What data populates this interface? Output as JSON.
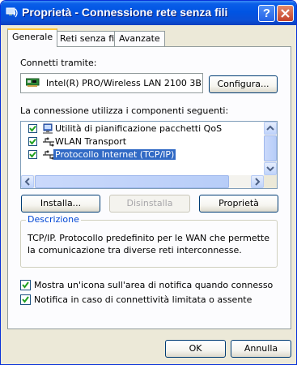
{
  "window": {
    "title": "Proprietà - Connessione rete senza fili",
    "help_label": "?"
  },
  "tabs": [
    {
      "label": "Generale",
      "active": true
    },
    {
      "label": "Reti senza fili",
      "active": false
    },
    {
      "label": "Avanzate",
      "active": false
    }
  ],
  "general": {
    "connect_using_label": "Connetti tramite:",
    "adapter_name": "Intel(R) PRO/Wireless LAN 2100 3B",
    "configure_button": "Configura...",
    "components_label": "La connessione utilizza i componenti seguenti:",
    "components": [
      {
        "label": "Utilità di pianificazione pacchetti QoS",
        "checked": true,
        "icon": "qos-icon",
        "selected": false
      },
      {
        "label": "WLAN Transport",
        "checked": true,
        "icon": "protocol-icon",
        "selected": false
      },
      {
        "label": "Protocollo Internet (TCP/IP)",
        "checked": true,
        "icon": "protocol-icon",
        "selected": true
      }
    ],
    "install_button": "Installa...",
    "uninstall_button": "Disinstalla",
    "properties_button": "Proprietà",
    "description_title": "Descrizione",
    "description_text": "TCP/IP. Protocollo predefinito per le WAN che permette la comunicazione tra diverse reti interconnesse.",
    "show_icon_option": {
      "label": "Mostra un'icona sull'area di notifica quando connesso",
      "checked": true
    },
    "notify_option": {
      "label": "Notifica in caso di connettività limitata o assente",
      "checked": true
    }
  },
  "footer": {
    "ok_button": "OK",
    "cancel_button": "Annulla"
  },
  "colors": {
    "titlebar": "#0054e3",
    "selection": "#316ac5",
    "group_title": "#0046d5",
    "dialog_bg": "#ece9d8"
  }
}
